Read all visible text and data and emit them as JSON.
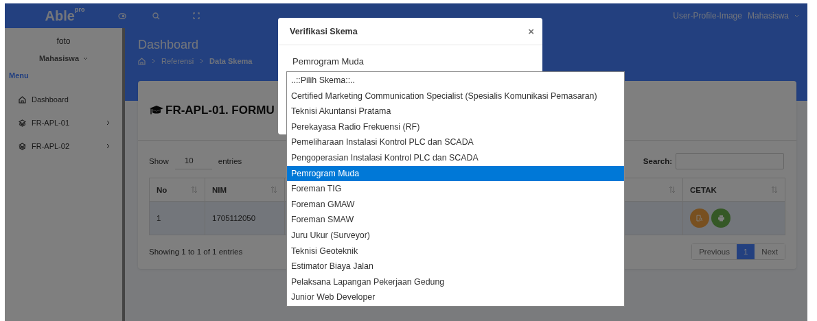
{
  "topbar": {
    "logo": "Able",
    "logo_badge": "pro",
    "profile_image_alt": "User-Profile-Image",
    "user": "Mahasiswa"
  },
  "sidebar": {
    "photo_alt": "foto",
    "role": "Mahasiswa",
    "section": "Menu",
    "items": [
      {
        "label": "Dashboard",
        "kind": "link"
      },
      {
        "label": "FR-APL-01",
        "kind": "submenu"
      },
      {
        "label": "FR-APL-02",
        "kind": "submenu"
      }
    ]
  },
  "page_header": {
    "title": "Dashboard",
    "breadcrumb": [
      "Referensi",
      "Data Skema"
    ]
  },
  "card": {
    "title": "FR-APL-01. FORMU",
    "show_label": "Show",
    "page_length": "10",
    "entries_label": "entries",
    "search_label": "Search:",
    "columns": [
      "No",
      "NIM"
    ],
    "last_column": "CETAK",
    "rows": [
      {
        "cells": [
          "1",
          "1705112050"
        ]
      }
    ],
    "info": "Showing 1 to 1 of 1 entries",
    "pagination": [
      {
        "label": "Previous",
        "selected": false
      },
      {
        "label": "1",
        "selected": true
      },
      {
        "label": "Next",
        "selected": false
      }
    ]
  },
  "modal": {
    "title": "Verifikasi Skema",
    "close": "×",
    "value": "Pemrogram Muda",
    "options": [
      {
        "label": "..::Pilih Skema::..",
        "selected": false
      },
      {
        "label": "Certified Marketing Communication Specialist (Spesialis Komunikasi Pemasaran)",
        "selected": false
      },
      {
        "label": "Teknisi Akuntansi Pratama",
        "selected": false
      },
      {
        "label": "Perekayasa Radio Frekuensi (RF)",
        "selected": false
      },
      {
        "label": "Pemeliharaan Instalasi Kontrol PLC dan SCADA",
        "selected": false
      },
      {
        "label": "Pengoperasian Instalasi Kontrol PLC dan SCADA",
        "selected": false
      },
      {
        "label": "Pemrogram Muda",
        "selected": true
      },
      {
        "label": "Foreman TIG",
        "selected": false
      },
      {
        "label": "Foreman GMAW",
        "selected": false
      },
      {
        "label": "Foreman SMAW",
        "selected": false
      },
      {
        "label": "Juru Ukur (Surveyor)",
        "selected": false
      },
      {
        "label": "Teknisi Geoteknik",
        "selected": false
      },
      {
        "label": "Estimator Biaya Jalan",
        "selected": false
      },
      {
        "label": "Pelaksana Lapangan Pekerjaan Gedung",
        "selected": false
      },
      {
        "label": "Junior Web Developer",
        "selected": false
      }
    ]
  }
}
